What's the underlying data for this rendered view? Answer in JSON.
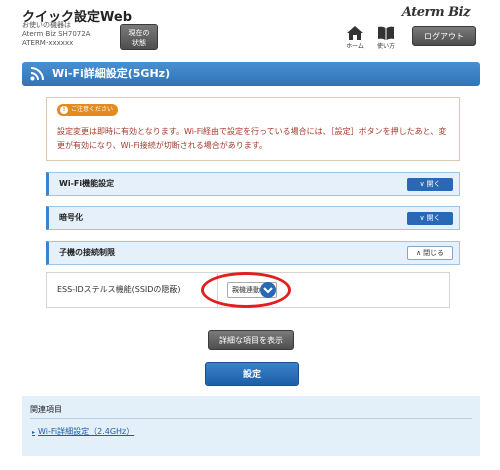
{
  "header": {
    "app_title": "クイック設定Web",
    "device_label": "お使いの機器は",
    "device_model": "Aterm Biz SH7072A",
    "device_id": "ATERM-xxxxxx",
    "status_line1": "現在の",
    "status_line2": "状態",
    "brand": "Aterm Biz",
    "home_label": "ホーム",
    "help_label": "使い方",
    "logout_label": "ログアウト"
  },
  "page": {
    "title": "Wi-Fi詳細設定(5GHz)"
  },
  "notice": {
    "label": "ご注意ください",
    "text": "設定変更は即時に有効となります。Wi-Fi経由で設定を行っている場合には、［設定］ボタンを押したあと、変更が有効になり、Wi-Fi接続が切断される場合があります。"
  },
  "sections": [
    {
      "title": "Wi-Fi機能設定",
      "button": "開く",
      "state": "collapsed"
    },
    {
      "title": "暗号化",
      "button": "開く",
      "state": "collapsed"
    },
    {
      "title": "子機の接続制限",
      "button": "閉じる",
      "state": "expanded"
    }
  ],
  "ssid_stealth": {
    "label": "ESS-IDステルス機能(SSIDの隠蔽)",
    "value": "親機連動"
  },
  "buttons": {
    "show_details": "詳細な項目を表示",
    "apply": "設定"
  },
  "related": {
    "title": "関連項目",
    "link": "Wi-Fi詳細設定（2.4GHz）"
  },
  "colors": {
    "primary_blue": "#2f74b8",
    "notice_orange": "#e58a1f",
    "notice_text": "#a13a2a",
    "highlight_red": "#e02020"
  }
}
